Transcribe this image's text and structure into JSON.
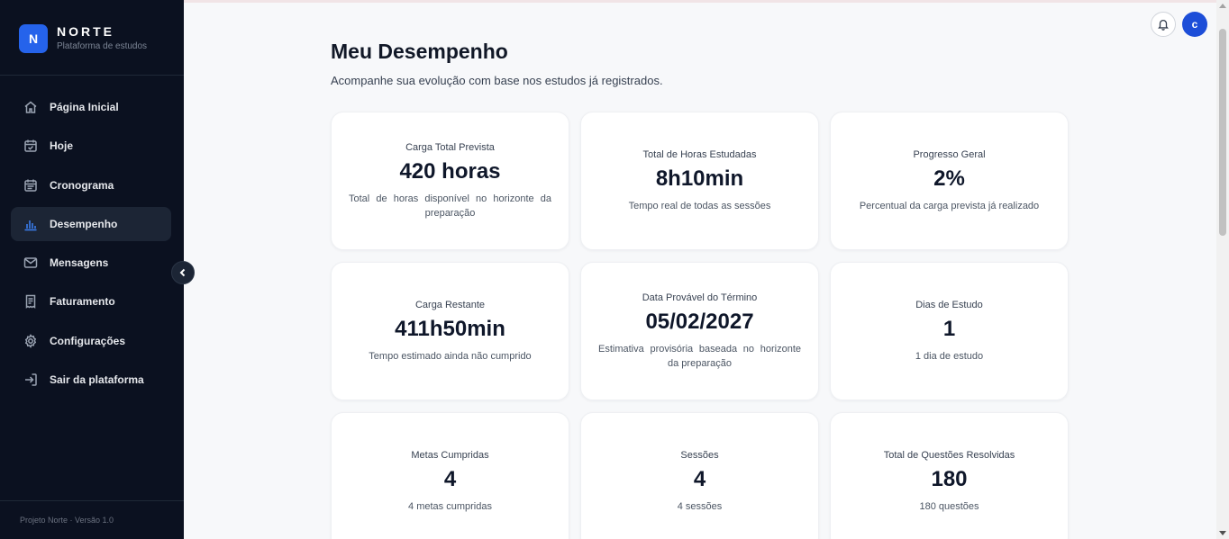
{
  "brand": {
    "logo_letter": "N",
    "name": "NORTE",
    "subtitle": "Plataforma de estudos"
  },
  "sidebar": {
    "items": [
      {
        "label": "Página Inicial",
        "icon": "home-icon",
        "active": false
      },
      {
        "label": "Hoje",
        "icon": "calendar-check-icon",
        "active": false
      },
      {
        "label": "Cronograma",
        "icon": "calendar-icon",
        "active": false
      },
      {
        "label": "Desempenho",
        "icon": "bar-chart-icon",
        "active": true
      },
      {
        "label": "Mensagens",
        "icon": "mail-icon",
        "active": false
      },
      {
        "label": "Faturamento",
        "icon": "receipt-icon",
        "active": false
      },
      {
        "label": "Configurações",
        "icon": "gear-icon",
        "active": false
      },
      {
        "label": "Sair da plataforma",
        "icon": "logout-icon",
        "active": false
      }
    ],
    "footer": "Projeto Norte · Versão 1.0"
  },
  "header": {
    "avatar_letter": "c"
  },
  "main": {
    "title": "Meu Desempenho",
    "subtitle": "Acompanhe sua evolução com base nos estudos já registrados.",
    "cards": [
      {
        "label": "Carga Total Prevista",
        "value": "420 horas",
        "desc": "Total de horas disponível no horizonte da preparação"
      },
      {
        "label": "Total de Horas Estudadas",
        "value": "8h10min",
        "desc": "Tempo real de todas as sessões"
      },
      {
        "label": "Progresso Geral",
        "value": "2%",
        "desc": "Percentual da carga prevista já realizado"
      },
      {
        "label": "Carga Restante",
        "value": "411h50min",
        "desc": "Tempo estimado ainda não cumprido"
      },
      {
        "label": "Data Provável do Término",
        "value": "05/02/2027",
        "desc": "Estimativa provisória baseada no horizonte da preparação"
      },
      {
        "label": "Dias de Estudo",
        "value": "1",
        "desc": "1 dia de estudo"
      },
      {
        "label": "Metas Cumpridas",
        "value": "4",
        "desc": "4 metas cumpridas"
      },
      {
        "label": "Sessões",
        "value": "4",
        "desc": "4 sessões"
      },
      {
        "label": "Total de Questões Resolvidas",
        "value": "180",
        "desc": "180 questões"
      }
    ]
  },
  "colors": {
    "sidebar_bg": "#0b1120",
    "accent": "#2563eb",
    "active_item_bg": "#1c2535",
    "page_bg": "#f7f8fa"
  }
}
